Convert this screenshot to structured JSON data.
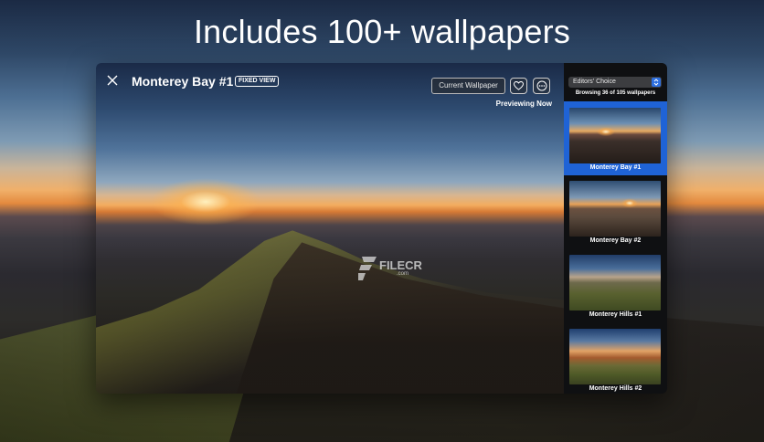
{
  "headline": "Includes 100+ wallpapers",
  "window": {
    "title": "Monterey Bay #1",
    "badge": "FIXED VIEW",
    "current_wallpaper_label": "Current Wallpaper",
    "previewing_label": "Previewing Now"
  },
  "watermark": {
    "text": "FILECR",
    "sub": ".com"
  },
  "sidebar": {
    "dropdown_value": "Editors' Choice",
    "browsing_text": "Browsing 36 of 105 wallpapers",
    "items": [
      {
        "label": "Monterey Bay #1",
        "selected": true
      },
      {
        "label": "Monterey Bay #2",
        "selected": false
      },
      {
        "label": "Monterey Hills #1",
        "selected": false
      },
      {
        "label": "Monterey Hills #2",
        "selected": false
      }
    ]
  },
  "icons": {
    "close": "close-icon",
    "favorite": "heart-icon",
    "more": "ellipsis-icon",
    "dropdown": "chevron-updown-icon"
  },
  "colors": {
    "selection": "#1f63d6",
    "sidebar_bg": "#0f1012"
  }
}
